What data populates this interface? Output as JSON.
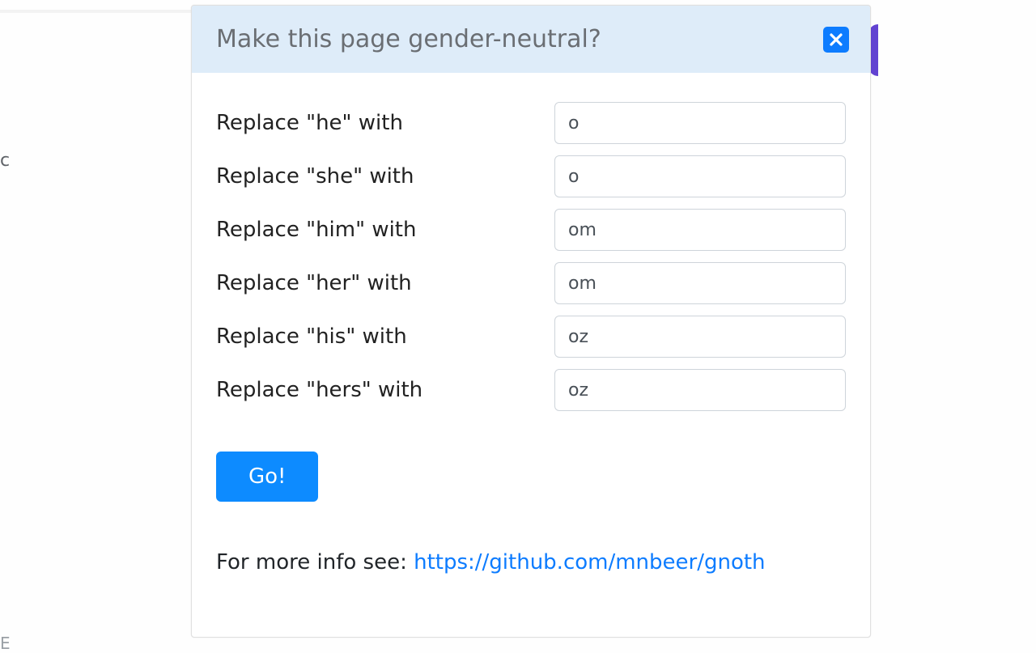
{
  "header": {
    "title": "Make this page gender-neutral?"
  },
  "fields": [
    {
      "label": "Replace \"he\" with",
      "value": "o"
    },
    {
      "label": "Replace \"she\" with",
      "value": "o"
    },
    {
      "label": "Replace \"him\" with",
      "value": "om"
    },
    {
      "label": "Replace \"her\" with",
      "value": "om"
    },
    {
      "label": "Replace \"his\" with",
      "value": "oz"
    },
    {
      "label": "Replace \"hers\" with",
      "value": "oz"
    }
  ],
  "actions": {
    "go_label": "Go!"
  },
  "footer": {
    "info_prefix": "For more info see: ",
    "info_link_text": "https://github.com/mnbeer/gnoth"
  }
}
